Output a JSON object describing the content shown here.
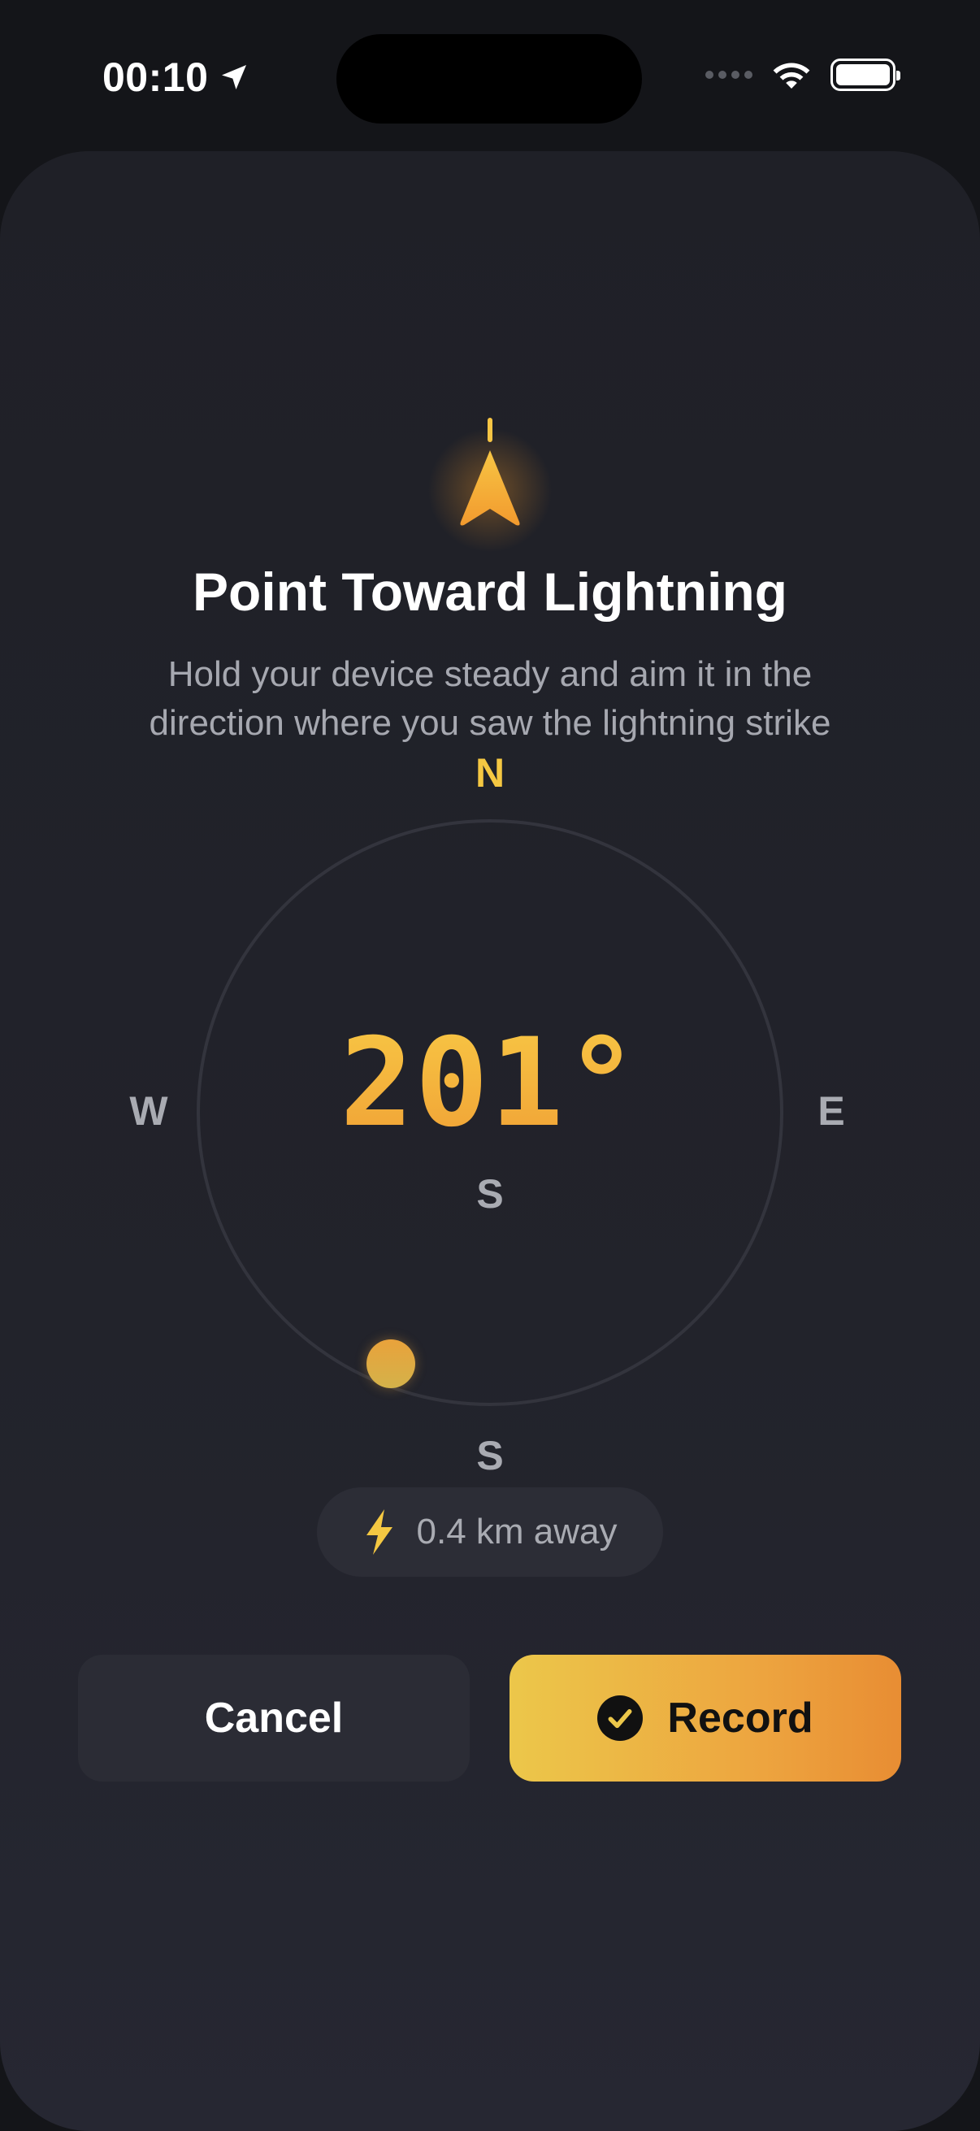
{
  "status_bar": {
    "time": "00:10"
  },
  "screen": {
    "title": "Point Toward Lightning",
    "subtitle": "Hold your device steady and aim it in the direction where you saw the lightning strike"
  },
  "compass": {
    "north": "N",
    "west": "W",
    "east": "E",
    "south": "S",
    "heading": "201°",
    "heading_cardinal": "S"
  },
  "distance": {
    "text": "0.4 km away"
  },
  "buttons": {
    "cancel": "Cancel",
    "record": "Record"
  },
  "colors": {
    "accent_yellow": "#f5c842",
    "accent_orange": "#e88d33",
    "background": "#1f2027"
  },
  "icons": {
    "status_location": "location-arrow-icon",
    "status_wifi": "wifi-icon",
    "status_battery": "battery-icon",
    "header": "direction-arrow-icon",
    "distance": "lightning-bolt-icon",
    "record": "checkmark-circle-icon"
  }
}
